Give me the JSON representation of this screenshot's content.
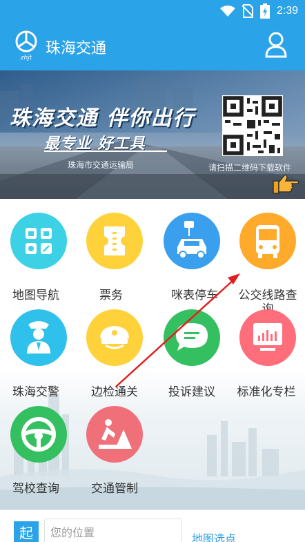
{
  "status_bar": {
    "time": "2:39",
    "icons": [
      "wifi-icon",
      "no-sim-icon",
      "battery-charging-icon"
    ]
  },
  "header": {
    "logo_text": "zhjt",
    "title": "珠海交通",
    "profile_icon": "user-icon"
  },
  "banner": {
    "headline": "珠海交通 伴你出行",
    "subline": "最专业  好工具",
    "org": "珠海市交通运输局",
    "qr_caption": "请扫描二维码下载软件",
    "hand_icon": "pointing-hand-icon"
  },
  "tiles": [
    {
      "label": "地图导航",
      "icon": "map-navigation-icon",
      "color": "#3dd1e6"
    },
    {
      "label": "票务",
      "icon": "ticket-icon",
      "color": "#ffd23c"
    },
    {
      "label": "咪表停车",
      "icon": "parking-meter-car-icon",
      "color": "#3aa0ee"
    },
    {
      "label": "公交线路查询",
      "icon": "bus-icon",
      "color": "#ffaa2a"
    },
    {
      "label": "珠海交警",
      "icon": "traffic-police-icon",
      "color": "#2fc0ec"
    },
    {
      "label": "边检通关",
      "icon": "border-inspection-cap-icon",
      "color": "#ffd23c"
    },
    {
      "label": "投诉建议",
      "icon": "chat-bubble-icon",
      "color": "#34c060"
    },
    {
      "label": "标准化专栏",
      "icon": "monitor-chart-icon",
      "color": "#ff6e7a"
    },
    {
      "label": "驾校查询",
      "icon": "steering-wheel-icon",
      "color": "#34c060"
    },
    {
      "label": "交通管制",
      "icon": "road-work-icon",
      "color": "#f0707a"
    }
  ],
  "bottom": {
    "start_label": "起",
    "location_placeholder": "您的位置",
    "map_pick": "地图选点"
  }
}
